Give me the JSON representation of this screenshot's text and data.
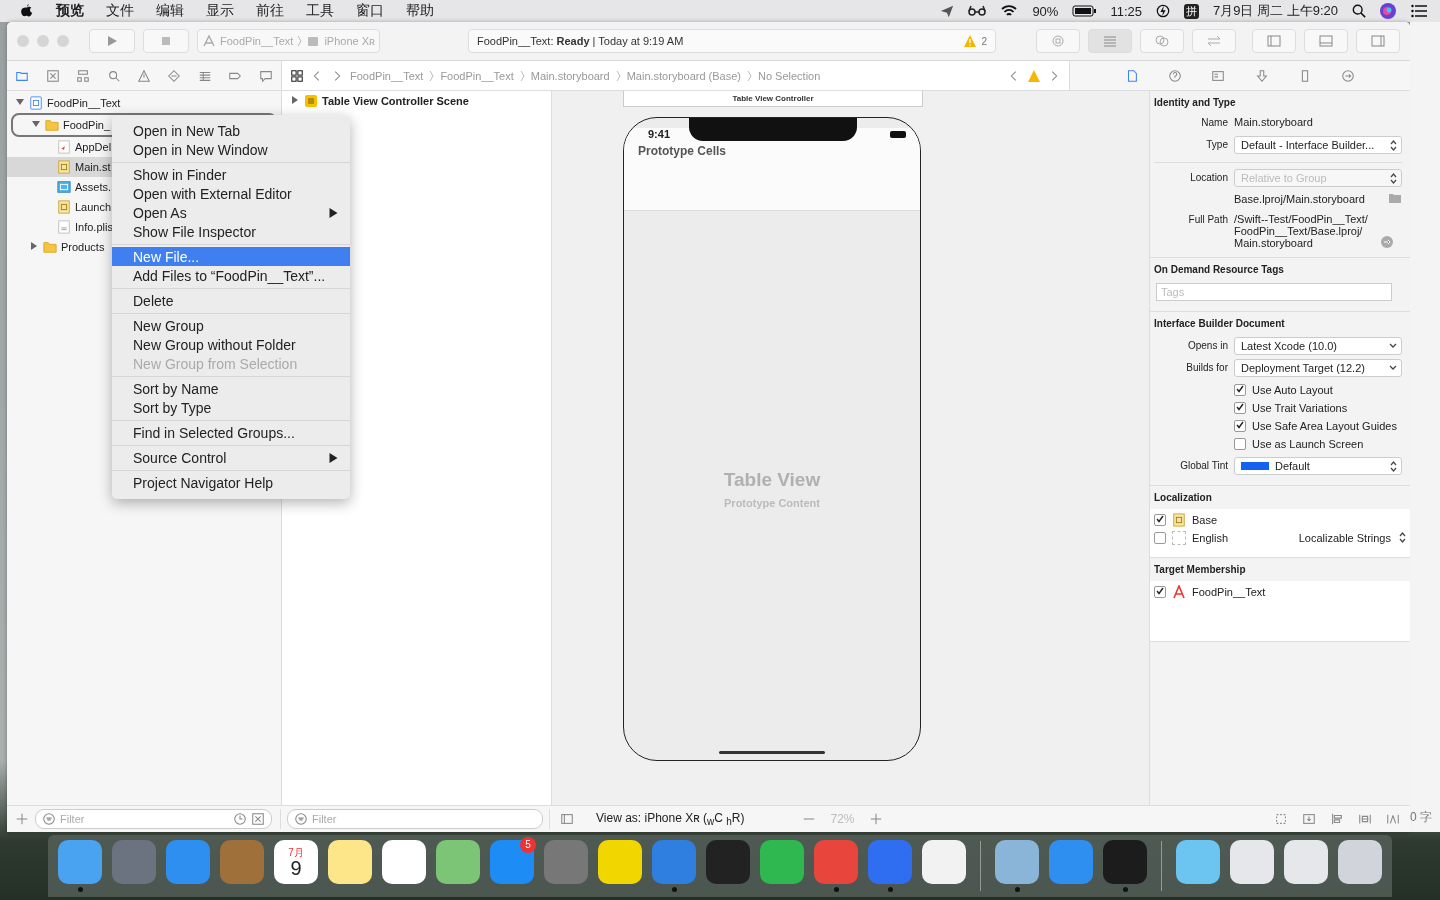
{
  "menubar": {
    "menus": [
      "预览",
      "文件",
      "编辑",
      "显示",
      "前往",
      "工具",
      "窗口",
      "帮助"
    ],
    "battery": "90%",
    "clock": "11:25",
    "input_method": "拼",
    "date": "7月9日 周二 上午9:20"
  },
  "toolbar": {
    "scheme": "FoodPin__Text",
    "device": "iPhone Xʀ",
    "activity_project": "FoodPin__Text: ",
    "activity_status": "Ready",
    "activity_time": " | Today at 9:19 AM",
    "warnings": "2"
  },
  "jump_bar": [
    "FoodPin__Text",
    "FoodPin__Text",
    "Main.storyboard",
    "Main.storyboard (Base)",
    "No Selection"
  ],
  "navigator": [
    {
      "label": "FoodPin__Text",
      "kind": "project",
      "expanded": true,
      "selected": false,
      "menu_target": false,
      "children": [
        {
          "label": "FoodPin_",
          "kind": "folder",
          "expanded": true,
          "selected": false,
          "menu_target": true,
          "children": [
            {
              "label": "AppDel",
              "kind": "swift",
              "selected": false,
              "menu_target": false
            },
            {
              "label": "Main.st",
              "kind": "storyboard",
              "selected": true,
              "menu_target": false
            },
            {
              "label": "Assets.",
              "kind": "assets",
              "selected": false,
              "menu_target": false
            },
            {
              "label": "Launch",
              "kind": "storyboard",
              "selected": false,
              "menu_target": false
            },
            {
              "label": "Info.plis",
              "kind": "plist",
              "selected": false,
              "menu_target": false
            }
          ]
        },
        {
          "label": "Products",
          "kind": "folder",
          "expanded": false,
          "selected": false,
          "menu_target": false
        }
      ]
    }
  ],
  "context_menu": [
    [
      {
        "label": "Open in New Tab",
        "kind": "item",
        "disabled": false,
        "selected": false
      },
      {
        "label": "Open in New Window",
        "kind": "item",
        "disabled": false,
        "selected": false
      }
    ],
    [
      {
        "label": "Show in Finder",
        "kind": "item",
        "disabled": false,
        "selected": false
      },
      {
        "label": "Open with External Editor",
        "kind": "item",
        "disabled": false,
        "selected": false
      },
      {
        "label": "Open As",
        "kind": "submenu",
        "disabled": false,
        "selected": false
      },
      {
        "label": "Show File Inspector",
        "kind": "item",
        "disabled": false,
        "selected": false
      }
    ],
    [
      {
        "label": "New File...",
        "kind": "item",
        "disabled": false,
        "selected": true
      },
      {
        "label": "Add Files to “FoodPin__Text”...",
        "kind": "item",
        "disabled": false,
        "selected": false
      }
    ],
    [
      {
        "label": "Delete",
        "kind": "item",
        "disabled": false,
        "selected": false
      }
    ],
    [
      {
        "label": "New Group",
        "kind": "item",
        "disabled": false,
        "selected": false
      },
      {
        "label": "New Group without Folder",
        "kind": "item",
        "disabled": false,
        "selected": false
      },
      {
        "label": "New Group from Selection",
        "kind": "item",
        "disabled": true,
        "selected": false
      }
    ],
    [
      {
        "label": "Sort by Name",
        "kind": "item",
        "disabled": false,
        "selected": false
      },
      {
        "label": "Sort by Type",
        "kind": "item",
        "disabled": false,
        "selected": false
      }
    ],
    [
      {
        "label": "Find in Selected Groups...",
        "kind": "item",
        "disabled": false,
        "selected": false
      }
    ],
    [
      {
        "label": "Source Control",
        "kind": "submenu",
        "disabled": false,
        "selected": false
      }
    ],
    [
      {
        "label": "Project Navigator Help",
        "kind": "item",
        "disabled": false,
        "selected": false
      }
    ]
  ],
  "outline": {
    "scene": "Table View Controller Scene",
    "expanded": false
  },
  "canvas": {
    "scene_title": "Table View Controller",
    "status_time": "9:41",
    "section": "Prototype Cells",
    "placeholder_title": "Table View",
    "placeholder_subtitle": "Prototype Content"
  },
  "bottom_bar": {
    "navigator_filter": "Filter",
    "outline_filter": "Filter",
    "view_as": "View as: iPhone Xʀ ($_{w}$C $_{h}$R)",
    "zoom": "72%"
  },
  "inspector": {
    "identity": {
      "title": "Identity and Type",
      "rows": [
        {
          "label": "Name",
          "value": "Main.storyboard",
          "kind": "text"
        },
        {
          "label": "Type",
          "value": "Default - Interface Builder...",
          "kind": "popup"
        },
        {
          "label": "Location",
          "value": "Relative to Group",
          "kind": "disabled_popup"
        },
        {
          "value": "Base.lproj/Main.storyboard",
          "kind": "path"
        },
        {
          "label": "Full Path",
          "value": "/Swift--Test/FoodPin__Text/ FoodPin__Text/Base.lproj/ Main.storyboard",
          "kind": "full_path"
        }
      ]
    },
    "tags": {
      "title": "On Demand Resource Tags",
      "placeholder": "Tags"
    },
    "document": {
      "title": "Interface Builder Document",
      "rows": [
        {
          "label": "Opens in",
          "value": "Latest Xcode (10.0)",
          "kind": "dropdown"
        },
        {
          "label": "Builds for",
          "value": "Deployment Target (12.2)",
          "kind": "dropdown"
        }
      ],
      "checks": [
        {
          "label": "Use Auto Layout",
          "checked": true
        },
        {
          "label": "Use Trait Variations",
          "checked": true
        },
        {
          "label": "Use Safe Area Layout Guides",
          "checked": true
        },
        {
          "label": "Use as Launch Screen",
          "checked": false
        }
      ],
      "tint_label": "Global Tint",
      "tint_value": "Default"
    },
    "localization": {
      "title": "Localization",
      "items": [
        {
          "label": "Base",
          "checked": true
        },
        {
          "label": "English",
          "checked": false,
          "value": "Localizable Strings"
        }
      ]
    },
    "target": {
      "title": "Target Membership",
      "items": [
        {
          "label": "FoodPin__Text",
          "checked": true
        }
      ]
    }
  },
  "desktop_text": "0 字",
  "dock": [
    {
      "kind": "finder",
      "running": true
    },
    {
      "kind": "launchpad",
      "running": false
    },
    {
      "kind": "safari",
      "running": false
    },
    {
      "kind": "contacts",
      "running": false
    },
    {
      "kind": "calendar",
      "running": false,
      "month": "7月",
      "day": "9"
    },
    {
      "kind": "notes",
      "running": false
    },
    {
      "kind": "reminders",
      "running": false
    },
    {
      "kind": "maps",
      "running": false
    },
    {
      "kind": "appstore",
      "running": false,
      "badge": "5"
    },
    {
      "kind": "settings",
      "running": false
    },
    {
      "kind": "music",
      "running": false
    },
    {
      "kind": "xcode",
      "running": true
    },
    {
      "kind": "penguin",
      "running": false
    },
    {
      "kind": "chat",
      "running": false
    },
    {
      "kind": "chrome",
      "running": true
    },
    {
      "kind": "wps",
      "running": true
    },
    {
      "kind": "textedit",
      "running": false
    },
    {
      "kind": "separator"
    },
    {
      "kind": "preview",
      "running": true
    },
    {
      "kind": "simulator",
      "running": false
    },
    {
      "kind": "terminal",
      "running": true
    },
    {
      "kind": "separator"
    },
    {
      "kind": "folder",
      "running": false
    },
    {
      "kind": "window",
      "running": false
    },
    {
      "kind": "window",
      "running": false
    },
    {
      "kind": "trash",
      "running": false
    }
  ]
}
